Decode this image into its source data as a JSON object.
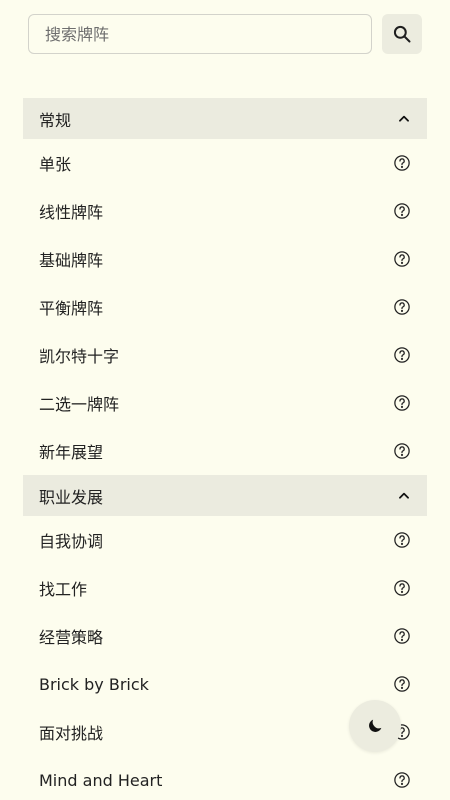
{
  "search": {
    "placeholder": "搜索牌阵"
  },
  "icons": {
    "search": "search-icon",
    "collapse": "chevron-up-icon",
    "help": "help-circle-icon",
    "theme_toggle": "moon-icon"
  },
  "colors": {
    "background": "#fdfdee",
    "section_header": "#ebebdf",
    "button": "#ececdf"
  },
  "sections": [
    {
      "title": "常规",
      "expanded": true,
      "items": [
        {
          "label": "单张"
        },
        {
          "label": "线性牌阵"
        },
        {
          "label": "基础牌阵"
        },
        {
          "label": "平衡牌阵"
        },
        {
          "label": "凯尔特十字"
        },
        {
          "label": "二选一牌阵"
        },
        {
          "label": "新年展望"
        }
      ]
    },
    {
      "title": "职业发展",
      "expanded": true,
      "items": [
        {
          "label": "自我协调"
        },
        {
          "label": "找工作"
        },
        {
          "label": "经营策略"
        },
        {
          "label": "Brick by Brick"
        },
        {
          "label": "面对挑战"
        },
        {
          "label": "Mind and Heart"
        }
      ]
    }
  ]
}
